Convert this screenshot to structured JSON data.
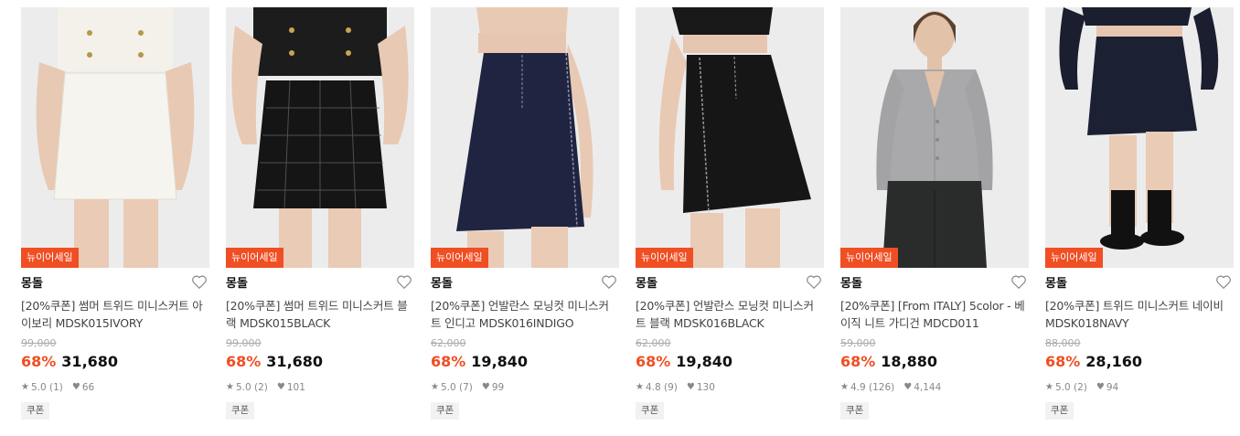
{
  "colors": {
    "accent": "#f04e23",
    "tag_bg": "#f2f2f2"
  },
  "icons": {
    "heart": "heart-outline-icon",
    "star": "star-icon",
    "like": "heart-filled-icon"
  },
  "products": [
    {
      "badge": "뉴이어세일",
      "brand": "몽돌",
      "title": "[20%쿠폰] 썸머 트위드 미니스커트 아이보리 MDSK015IVORY",
      "original_price": "99,000",
      "discount": "68%",
      "price": "31,680",
      "rating": "5.0",
      "reviews": "(1)",
      "likes": "66",
      "tag": "쿠폰",
      "garment": "ivory-tweed-skirt"
    },
    {
      "badge": "뉴이어세일",
      "brand": "몽돌",
      "title": "[20%쿠폰] 썸머 트위드 미니스커트 블랙 MDSK015BLACK",
      "original_price": "99,000",
      "discount": "68%",
      "price": "31,680",
      "rating": "5.0",
      "reviews": "(2)",
      "likes": "101",
      "tag": "쿠폰",
      "garment": "black-tweed-skirt"
    },
    {
      "badge": "뉴이어세일",
      "brand": "몽돌",
      "title": "[20%쿠폰] 언발란스 모닝컷 미니스커트 인디고 MDSK016INDIGO",
      "original_price": "62,000",
      "discount": "68%",
      "price": "19,840",
      "rating": "5.0",
      "reviews": "(7)",
      "likes": "99",
      "tag": "쿠폰",
      "garment": "indigo-denim-skirt"
    },
    {
      "badge": "뉴이어세일",
      "brand": "몽돌",
      "title": "[20%쿠폰] 언발란스 모닝컷 미니스커트 블랙 MDSK016BLACK",
      "original_price": "62,000",
      "discount": "68%",
      "price": "19,840",
      "rating": "4.8",
      "reviews": "(9)",
      "likes": "130",
      "tag": "쿠폰",
      "garment": "black-denim-skirt"
    },
    {
      "badge": "뉴이어세일",
      "brand": "몽돌",
      "title": "[20%쿠폰] [From ITALY] 5color - 베이직 니트 가디건 MDCD011",
      "original_price": "59,000",
      "discount": "68%",
      "price": "18,880",
      "rating": "4.9",
      "reviews": "(126)",
      "likes": "4,144",
      "tag": "쿠폰",
      "garment": "grey-knit-cardigan"
    },
    {
      "badge": "뉴이어세일",
      "brand": "몽돌",
      "title": "[20%쿠폰] 트위드 미니스커트 네이비 MDSK018NAVY",
      "original_price": "88,000",
      "discount": "68%",
      "price": "28,160",
      "rating": "5.0",
      "reviews": "(2)",
      "likes": "94",
      "tag": "쿠폰",
      "garment": "navy-tweed-skirt"
    }
  ]
}
